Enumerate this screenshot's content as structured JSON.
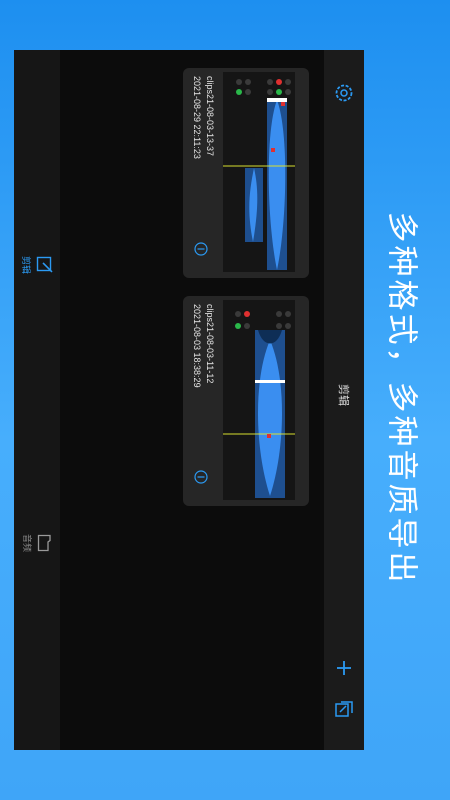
{
  "promo": {
    "caption": "多种格式，多种音质导出"
  },
  "sidebar": {
    "tabs": [
      {
        "label": "剪辑",
        "icon": "edit-icon",
        "active": true
      },
      {
        "label": "音频",
        "icon": "folder-icon",
        "active": false
      }
    ]
  },
  "toolbar": {
    "title": "剪辑",
    "icons": [
      "settings-gear-icon",
      "add-icon",
      "import-icon"
    ]
  },
  "clips": [
    {
      "name": "clips21-08-03-13-37",
      "date": "2021-08-29 22:11:23"
    },
    {
      "name": "clips21-08-03-11-12",
      "date": "2021-08-03 18:38:29"
    }
  ],
  "colors": {
    "accent": "#2b9af3",
    "waveform": "#3a8ef0",
    "background_gradient_top": "#1d8ff0",
    "app_background": "#0c0c0c"
  }
}
